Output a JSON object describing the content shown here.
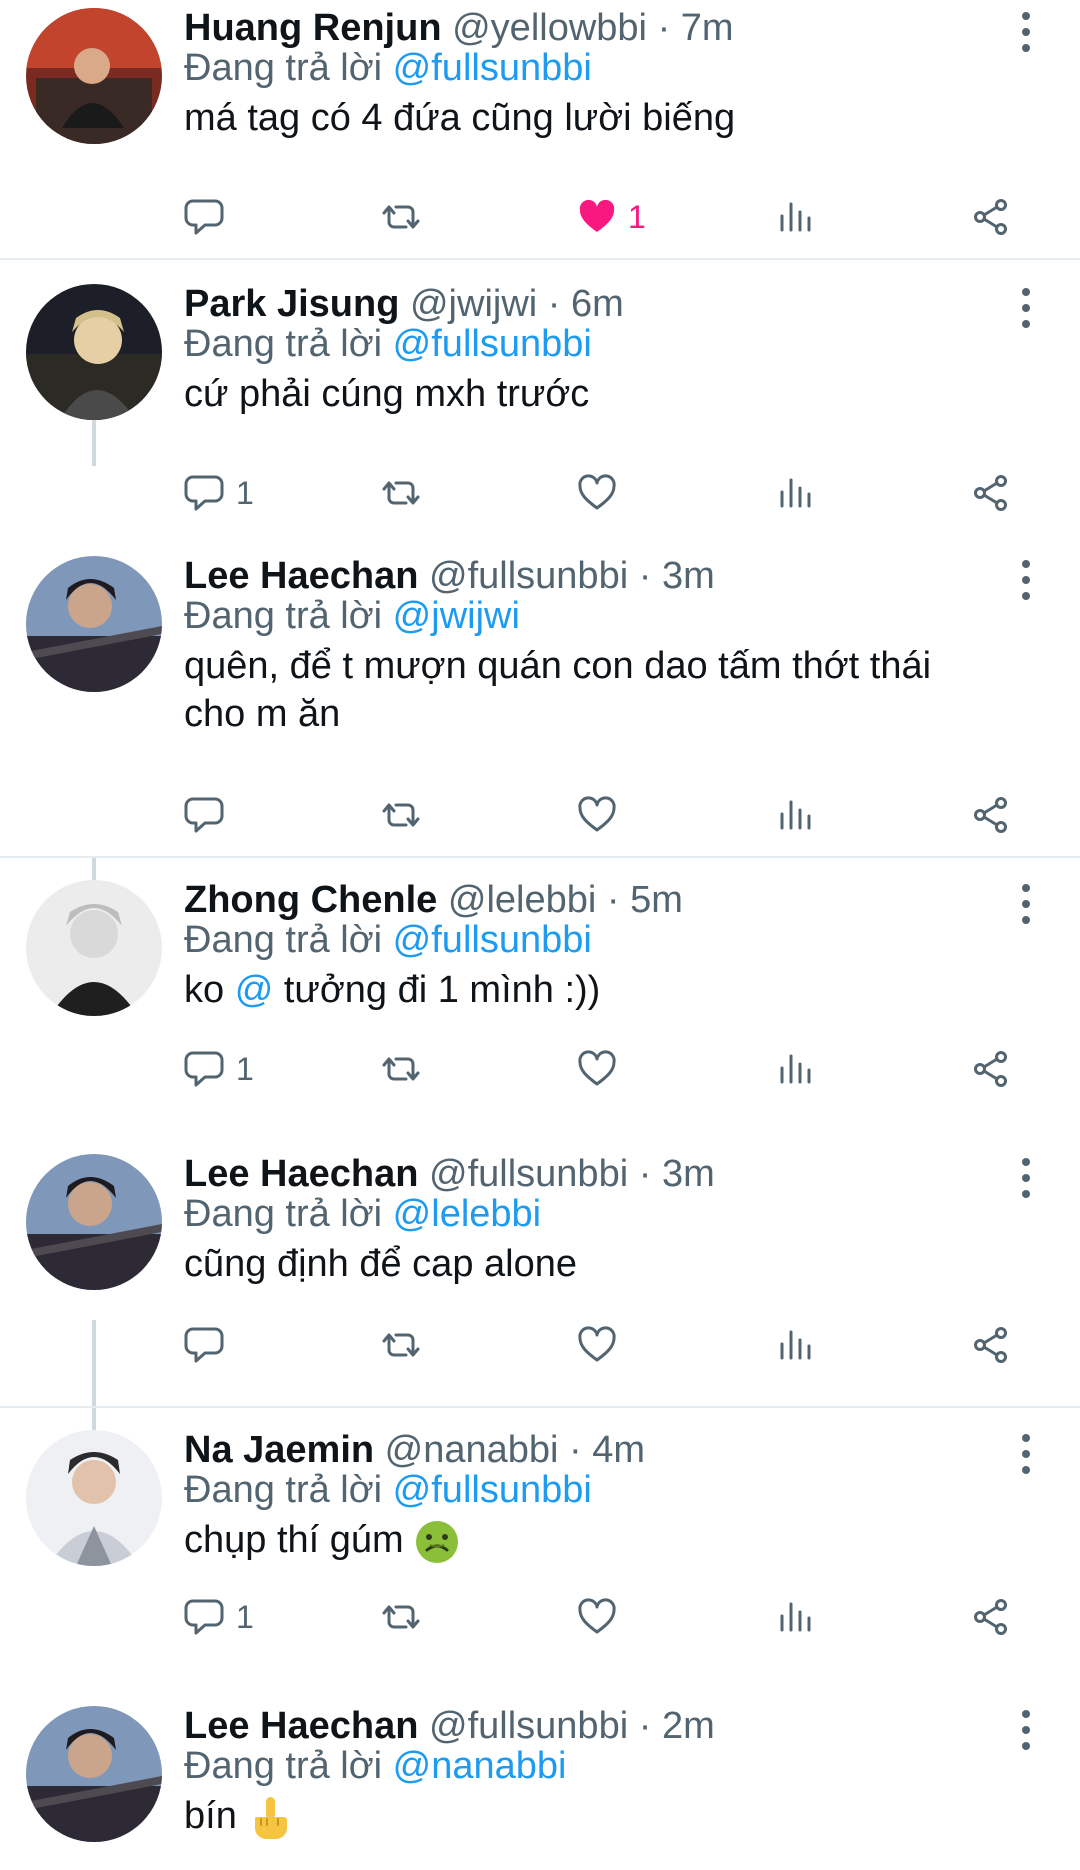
{
  "tweets": [
    {
      "name": "Huang Renjun",
      "handle": "@yellowbbi",
      "sep": "·",
      "time": "7m",
      "reply_prefix": "Đang trả lời",
      "reply_to": "@fullsunbbi",
      "text": "má tag có 4 đứa cũng lười biếng",
      "reply_count": "",
      "like_count": "1",
      "liked": true,
      "avatar_colors": [
        "#7a2a20",
        "#c2442c"
      ]
    },
    {
      "name": "Park Jisung",
      "handle": "@jwijwi",
      "sep": "·",
      "time": "6m",
      "reply_prefix": "Đang trả lời",
      "reply_to": "@fullsunbbi",
      "text": "cứ phải cúng mxh trước",
      "reply_count": "1",
      "like_count": "",
      "liked": false,
      "avatar_colors": [
        "#1d1f28",
        "#8a7a55"
      ]
    },
    {
      "name": "Lee Haechan",
      "handle": "@fullsunbbi",
      "sep": "·",
      "time": "3m",
      "reply_prefix": "Đang trả lời",
      "reply_to": "@jwijwi",
      "text_line1": "quên, để t mượn quán con dao tấm thớt thái",
      "text_line2": "cho m ăn",
      "reply_count": "",
      "like_count": "",
      "liked": false,
      "avatar_colors": [
        "#6d86a8",
        "#2d2a35"
      ]
    },
    {
      "name": "Zhong Chenle",
      "handle": "@lelebbi",
      "sep": "·",
      "time": "5m",
      "reply_prefix": "Đang trả lời",
      "reply_to": "@fullsunbbi",
      "text_pre": "ko",
      "text_mention": "@",
      "text_post": "tưởng đi 1 mình :))",
      "reply_count": "1",
      "like_count": "",
      "liked": false,
      "avatar_colors": [
        "#e9e9e9",
        "#3a3a3a"
      ]
    },
    {
      "name": "Lee Haechan",
      "handle": "@fullsunbbi",
      "sep": "·",
      "time": "3m",
      "reply_prefix": "Đang trả lời",
      "reply_to": "@lelebbi",
      "text": "cũng định để cap alone",
      "reply_count": "",
      "like_count": "",
      "liked": false,
      "avatar_colors": [
        "#6d86a8",
        "#2d2a35"
      ]
    },
    {
      "name": "Na Jaemin",
      "handle": "@nanabbi",
      "sep": "·",
      "time": "4m",
      "reply_prefix": "Đang trả lời",
      "reply_to": "@fullsunbbi",
      "text": "chụp thí gúm",
      "emoji": "nauseated-face",
      "reply_count": "1",
      "like_count": "",
      "liked": false,
      "avatar_colors": [
        "#e6e8ec",
        "#9aa0a8"
      ]
    },
    {
      "name": "Lee Haechan",
      "handle": "@fullsunbbi",
      "sep": "·",
      "time": "2m",
      "reply_prefix": "Đang trả lời",
      "reply_to": "@nanabbi",
      "text": "bín",
      "emoji": "middle-finger",
      "reply_count": "",
      "like_count": "",
      "liked": false,
      "avatar_colors": [
        "#6d86a8",
        "#2d2a35"
      ]
    }
  ],
  "colors": {
    "accent": "#1d9bf0",
    "like": "#f91880",
    "muted": "#536471"
  },
  "icons": [
    "reply-icon",
    "retweet-icon",
    "like-icon",
    "stats-icon",
    "share-icon",
    "more-icon"
  ]
}
